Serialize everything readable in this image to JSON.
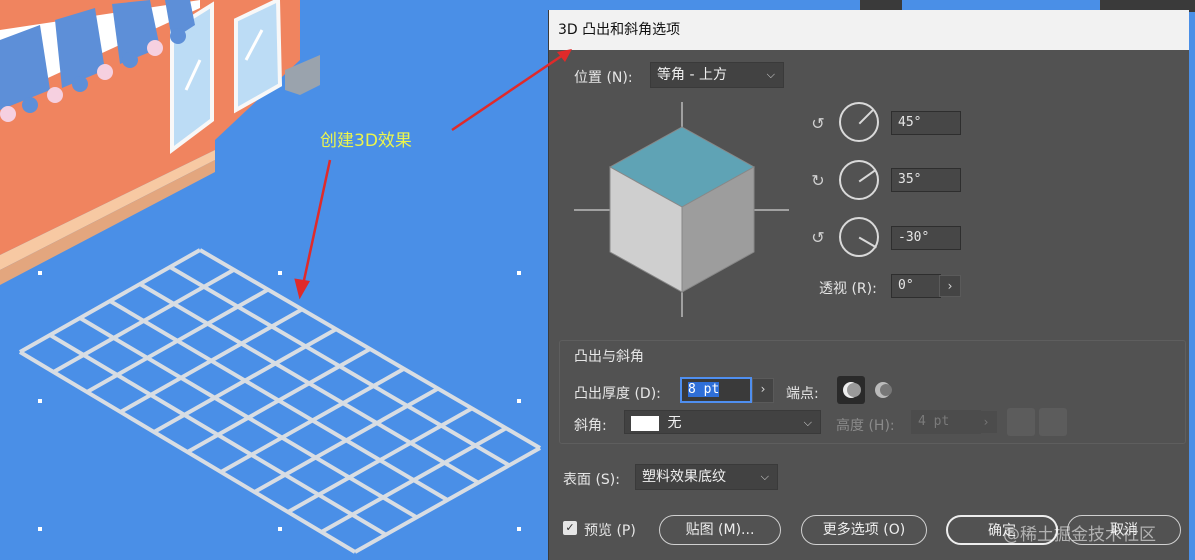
{
  "annotation": "创建3D效果",
  "dialog": {
    "title": "3D 凸出和斜角选项",
    "position_label": "位置 (N):",
    "position_value": "等角 - 上方",
    "rotation_x": "45°",
    "rotation_y": "35°",
    "rotation_z": "-30°",
    "perspective_label": "透视 (R):",
    "perspective_value": "0°",
    "extrude_section_title": "凸出与斜角",
    "extrude_depth_label": "凸出厚度 (D):",
    "extrude_depth_value": "8 pt",
    "cap_label": "端点:",
    "bevel_label": "斜角:",
    "bevel_value": "无",
    "height_label": "高度 (H):",
    "height_value": "4 pt",
    "surface_label": "表面 (S):",
    "surface_value": "塑料效果底纹",
    "preview_label": "预览 (P)",
    "map_button": "贴图 (M)...",
    "more_options_button": "更多选项 (O)",
    "ok_button": "确定",
    "cancel_button": "取消"
  },
  "watermark": "@稀土掘金技术社区",
  "colors": {
    "canvas_bg": "#4a8fe7",
    "dialog_bg": "#525252",
    "cube_top": "#5fa3b5",
    "arrow": "#e02a2a",
    "annotation": "#ecf54b"
  }
}
